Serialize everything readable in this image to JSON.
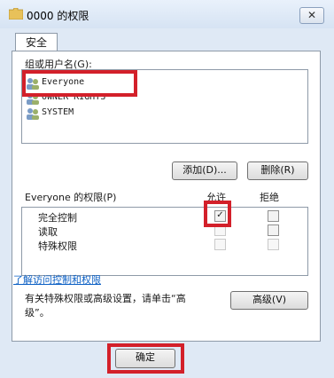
{
  "window": {
    "title": "0000 的权限",
    "close_glyph": "✕"
  },
  "tabs": [
    {
      "label": "安全"
    }
  ],
  "groups": {
    "label": "组或用户名(G):",
    "items": [
      {
        "name": "Everyone",
        "icon": "users-icon"
      },
      {
        "name": "OWNER RIGHTS",
        "icon": "users-icon"
      },
      {
        "name": "SYSTEM",
        "icon": "users-icon"
      }
    ],
    "add_label": "添加(D)...",
    "remove_label": "删除(R)"
  },
  "permissions": {
    "label": "Everyone 的权限(P)",
    "allow_header": "允许",
    "deny_header": "拒绝",
    "rows": [
      {
        "name": "完全控制",
        "allow": true,
        "deny": false
      },
      {
        "name": "读取",
        "allow": false,
        "deny": false
      },
      {
        "name": "特殊权限",
        "allow": false,
        "deny": false
      }
    ]
  },
  "advanced": {
    "text_line1": "有关特殊权限或高级设置，请单击“高",
    "text_line2": "级”。",
    "button_label": "高级(V)"
  },
  "learn_link": "了解访问控制和权限",
  "footer": {
    "ok_label": "确定"
  },
  "colors": {
    "highlight": "#d3202a",
    "link": "#0b5fc4",
    "window_bg": "#dfe9f5"
  }
}
